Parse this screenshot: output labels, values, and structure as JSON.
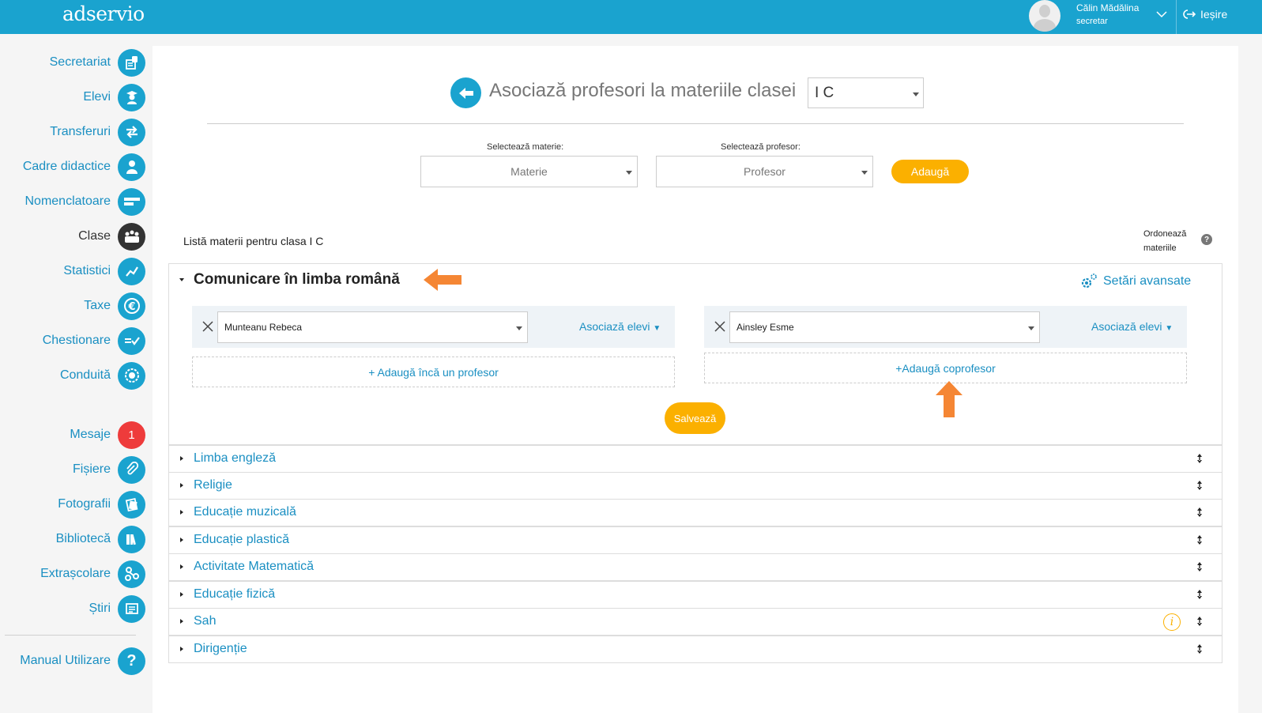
{
  "app": {
    "logo": "adservio"
  },
  "user": {
    "name": "Călin Mădălina",
    "role": "secretar",
    "logout": "Ieșire"
  },
  "sidebar": {
    "items": [
      {
        "label": "Secretariat",
        "icon": "secretariat-icon"
      },
      {
        "label": "Elevi",
        "icon": "student-icon"
      },
      {
        "label": "Transferuri",
        "icon": "transfer-icon"
      },
      {
        "label": "Cadre didactice",
        "icon": "teacher-icon"
      },
      {
        "label": "Nomenclatoare",
        "icon": "nomenclature-icon"
      },
      {
        "label": "Clase",
        "icon": "classes-icon",
        "active": true
      },
      {
        "label": "Statistici",
        "icon": "statistics-icon"
      },
      {
        "label": "Taxe",
        "icon": "euro-icon"
      },
      {
        "label": "Chestionare",
        "icon": "questionnaire-icon"
      },
      {
        "label": "Conduită",
        "icon": "conduct-icon"
      },
      {
        "label": "Mesaje",
        "icon": "messages-badge",
        "badge": "1"
      },
      {
        "label": "Fișiere",
        "icon": "paperclip-icon"
      },
      {
        "label": "Fotografii",
        "icon": "photos-icon"
      },
      {
        "label": "Bibliotecă",
        "icon": "library-icon"
      },
      {
        "label": "Extrașcolare",
        "icon": "extracurricular-icon"
      },
      {
        "label": "Știri",
        "icon": "news-icon"
      }
    ],
    "manual": {
      "label": "Manual Utilizare",
      "icon_text": "?"
    }
  },
  "main": {
    "title": "Asociază profesori la materiile clasei",
    "class_value": "I C",
    "subject_label": "Selectează materie:",
    "subject_placeholder": "Materie",
    "teacher_label": "Selectează profesor:",
    "teacher_placeholder": "Profesor",
    "add_label": "Adaugă",
    "list_title": "Listă materii pentru clasa I C",
    "order_label_1": "Ordonează",
    "order_label_2": "materiile",
    "help_text": "?"
  },
  "expanded_subject": {
    "name": "Comunicare în limba română",
    "advanced_settings": "Setări avansate",
    "left": {
      "teacher": "Munteanu Rebeca",
      "assoc": "Asociază elevi",
      "add": "+ Adaugă încă un profesor"
    },
    "right": {
      "teacher": "Ainsley Esme",
      "assoc": "Asociază elevi",
      "add": "+Adaugă coprofesor"
    },
    "save": "Salvează"
  },
  "subjects": [
    {
      "name": "Limba engleză"
    },
    {
      "name": "Religie"
    },
    {
      "name": "Educație muzicală"
    },
    {
      "name": "Educație plastică"
    },
    {
      "name": "Activitate Matematică"
    },
    {
      "name": "Educație fizică"
    },
    {
      "name": "Sah",
      "info": "i"
    },
    {
      "name": "Dirigenție"
    }
  ],
  "colors": {
    "primary": "#1aa3cf",
    "accent": "#fbb000",
    "arrow": "#f58634",
    "badge": "#ee3b3b"
  }
}
